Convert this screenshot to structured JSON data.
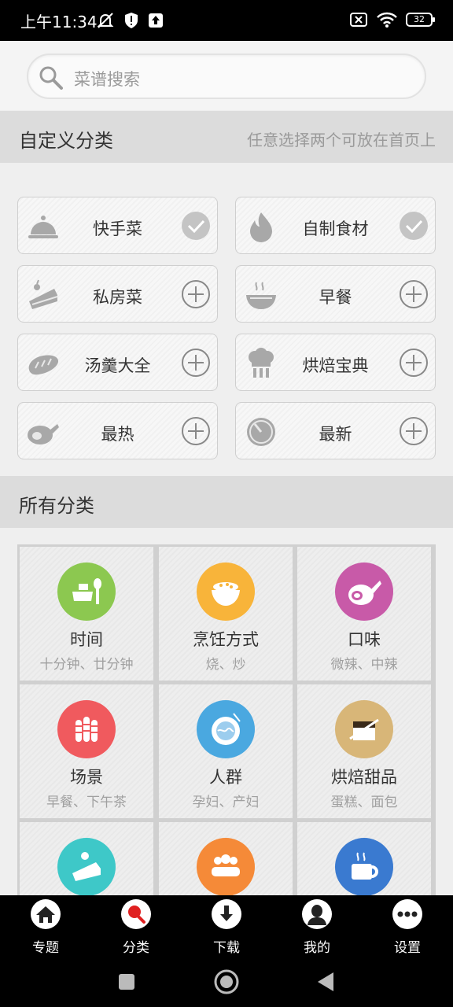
{
  "status_bar": {
    "time": "上午11:34",
    "battery": "32"
  },
  "search": {
    "placeholder": "菜谱搜索"
  },
  "custom_section": {
    "title": "自定义分类",
    "hint": "任意选择两个可放在首页上",
    "items": [
      {
        "label": "快手菜",
        "icon": "cloche-icon",
        "selected": true
      },
      {
        "label": "自制食材",
        "icon": "flame-icon",
        "selected": true
      },
      {
        "label": "私房菜",
        "icon": "cake-slice-icon",
        "selected": false
      },
      {
        "label": "早餐",
        "icon": "bowl-icon",
        "selected": false
      },
      {
        "label": "汤羹大全",
        "icon": "bread-icon",
        "selected": false
      },
      {
        "label": "烘焙宝典",
        "icon": "chef-hat-icon",
        "selected": false
      },
      {
        "label": "最热",
        "icon": "ham-icon",
        "selected": false
      },
      {
        "label": "最新",
        "icon": "clock-icon",
        "selected": false
      }
    ]
  },
  "all_section": {
    "title": "所有分类",
    "tiles": [
      {
        "name": "时间",
        "sub": "十分钟、廿分钟",
        "color": "#8cc850",
        "icon": "meal-icon"
      },
      {
        "name": "烹饪方式",
        "sub": "烧、炒",
        "color": "#f8b43a",
        "icon": "bowl-icon"
      },
      {
        "name": "口味",
        "sub": "微辣、中辣",
        "color": "#c85aa8",
        "icon": "ham-icon"
      },
      {
        "name": "场景",
        "sub": "早餐、下午茶",
        "color": "#f05a5e",
        "icon": "wheat-icon"
      },
      {
        "name": "人群",
        "sub": "孕妇、产妇",
        "color": "#4aa8e0",
        "icon": "noodle-icon"
      },
      {
        "name": "烘焙甜品",
        "sub": "蛋糕、面包",
        "color": "#d8b678",
        "icon": "dessert-icon"
      },
      {
        "name": "",
        "sub": "",
        "color": "#3ec8c8",
        "icon": "cake-icon"
      },
      {
        "name": "",
        "sub": "",
        "color": "#f58a38",
        "icon": "people-icon"
      },
      {
        "name": "",
        "sub": "",
        "color": "#3a7ad0",
        "icon": "cup-icon"
      }
    ]
  },
  "bottom_nav": {
    "items": [
      {
        "label": "专题",
        "icon": "home-icon"
      },
      {
        "label": "分类",
        "icon": "search-icon",
        "active": true
      },
      {
        "label": "下载",
        "icon": "download-icon"
      },
      {
        "label": "我的",
        "icon": "user-icon"
      },
      {
        "label": "设置",
        "icon": "more-icon"
      }
    ]
  }
}
